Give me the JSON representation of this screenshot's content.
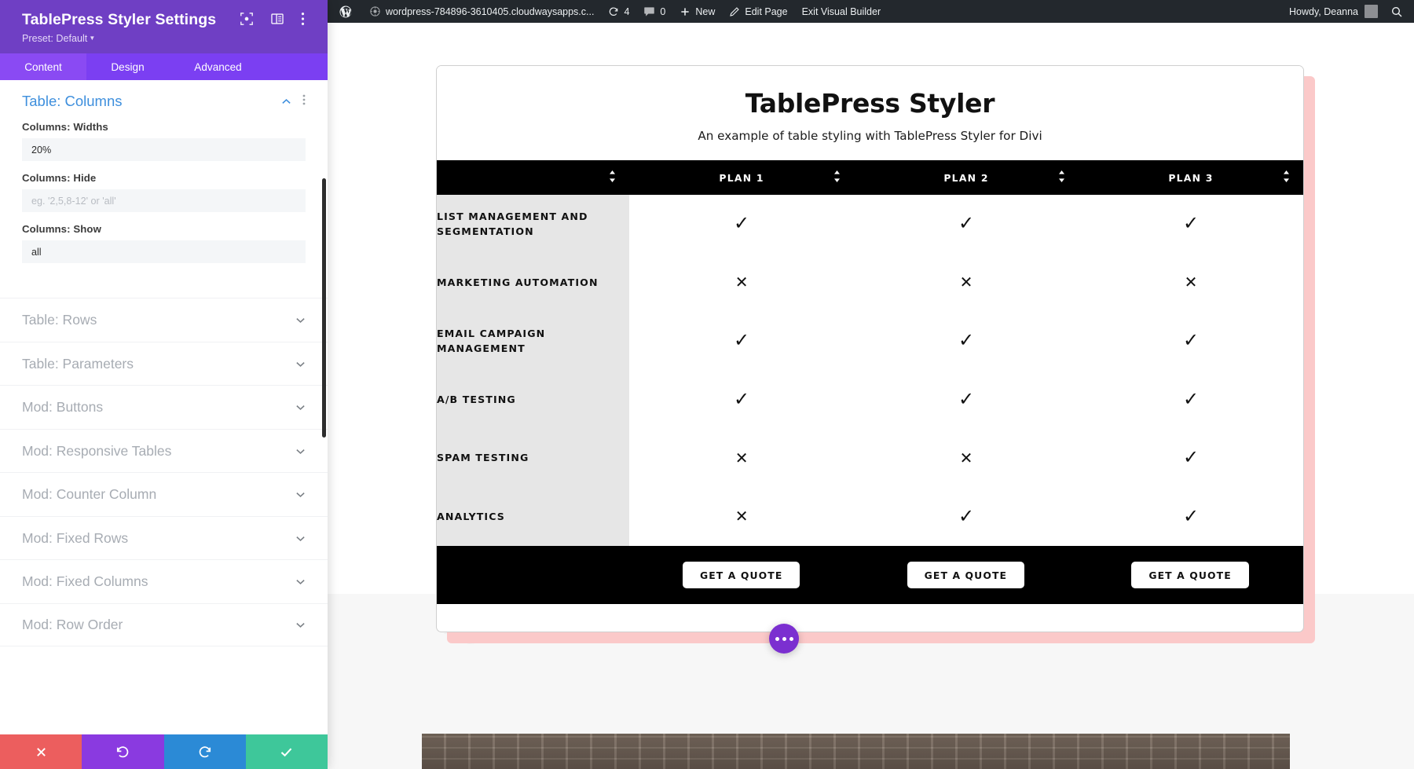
{
  "settings_panel": {
    "title": "TablePress Styler Settings",
    "preset_label": "Preset: Default",
    "head_icons": [
      {
        "name": "focus-target-icon"
      },
      {
        "name": "layout-panel-icon"
      },
      {
        "name": "more-vertical-icon"
      }
    ],
    "tabs": [
      {
        "label": "Content",
        "active": true
      },
      {
        "label": "Design",
        "active": false
      },
      {
        "label": "Advanced",
        "active": false
      }
    ],
    "open_section": {
      "title": "Table: Columns",
      "fields": [
        {
          "label": "Columns: Widths",
          "value": "20%",
          "placeholder": ""
        },
        {
          "label": "Columns: Hide",
          "value": "",
          "placeholder": "eg. '2,5,8-12' or 'all'"
        },
        {
          "label": "Columns: Show",
          "value": "all",
          "placeholder": ""
        }
      ]
    },
    "sections": [
      {
        "label": "Table: Rows"
      },
      {
        "label": "Table: Parameters"
      },
      {
        "label": "Mod: Buttons"
      },
      {
        "label": "Mod: Responsive Tables"
      },
      {
        "label": "Mod: Counter Column"
      },
      {
        "label": "Mod: Fixed Rows"
      },
      {
        "label": "Mod: Fixed Columns"
      },
      {
        "label": "Mod: Row Order"
      }
    ],
    "footer_buttons": [
      {
        "name": "cancel-button",
        "icon": "close-icon",
        "color": "#ec5e5e"
      },
      {
        "name": "undo-button",
        "icon": "undo-icon",
        "color": "#8a3ae0"
      },
      {
        "name": "redo-button",
        "icon": "redo-icon",
        "color": "#2b8ad6"
      },
      {
        "name": "save-button",
        "icon": "check-icon",
        "color": "#3ec79a"
      }
    ]
  },
  "adminbar": {
    "site_name": "wordpress-784896-3610405.cloudwaysapps.c...",
    "updates_count": "4",
    "comments_count": "0",
    "new_label": "New",
    "edit_page_label": "Edit Page",
    "exit_builder_label": "Exit Visual Builder",
    "howdy": "Howdy, Deanna"
  },
  "table_card": {
    "title": "TablePress Styler",
    "subtitle": "An example of table styling with TablePress Styler for Divi",
    "columns": [
      "",
      "PLAN 1",
      "PLAN 2",
      "PLAN 3"
    ],
    "rows": [
      {
        "feature": "LIST MANAGEMENT AND SEGMENTATION",
        "values": [
          "yes",
          "yes",
          "yes"
        ]
      },
      {
        "feature": "MARKETING AUTOMATION",
        "values": [
          "no",
          "no",
          "no"
        ]
      },
      {
        "feature": "EMAIL CAMPAIGN MANAGEMENT",
        "values": [
          "yes",
          "yes",
          "yes"
        ]
      },
      {
        "feature": "A/B TESTING",
        "values": [
          "yes",
          "yes",
          "yes"
        ]
      },
      {
        "feature": "SPAM TESTING",
        "values": [
          "no",
          "no",
          "yes"
        ]
      },
      {
        "feature": "ANALYTICS",
        "values": [
          "no",
          "yes",
          "yes"
        ]
      }
    ],
    "footer_buttons": [
      "GET A QUOTE",
      "GET A QUOTE",
      "GET A QUOTE"
    ],
    "glyphs": {
      "yes": "✓",
      "no": "✕"
    },
    "colors": {
      "header_bg": "#000000",
      "feature_bg": "#e6e6e6",
      "shadow": "#fbc9c9",
      "accent_purple": "#7b3ff2"
    }
  }
}
